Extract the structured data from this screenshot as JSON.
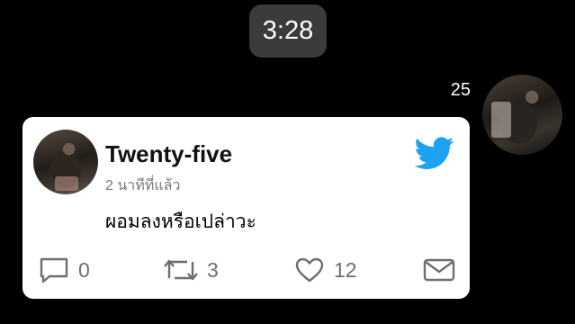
{
  "status": {
    "time": "3:28"
  },
  "sender": {
    "name": "25"
  },
  "card": {
    "name": "Twenty-five",
    "time_ago": "2 นาทีที่แล้ว",
    "text": "ผอมลงหรือเปล่าวะ",
    "brand_icon": "twitter-icon",
    "brand_color": "#1DA1F2",
    "actions": {
      "reply": {
        "icon": "reply-icon",
        "count": "0"
      },
      "retweet": {
        "icon": "retweet-icon",
        "count": "3"
      },
      "like": {
        "icon": "heart-icon",
        "count": "12"
      },
      "message": {
        "icon": "mail-icon"
      }
    }
  }
}
